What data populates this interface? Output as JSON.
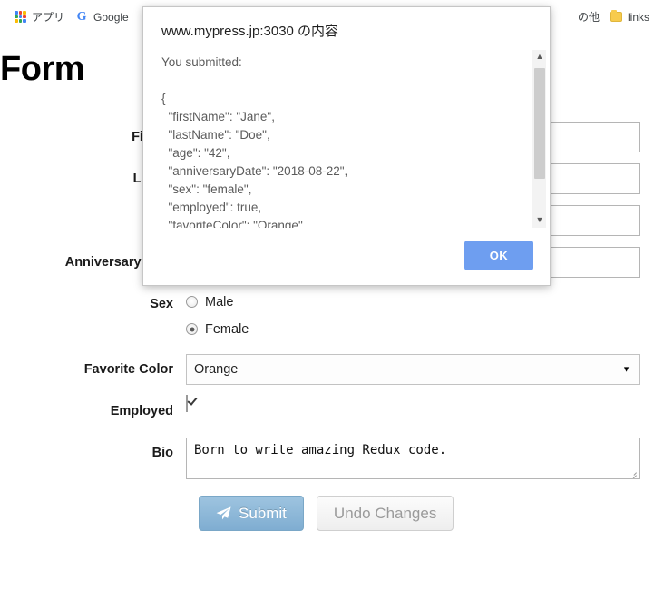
{
  "browser": {
    "bookmarks": [
      {
        "label": "アプリ",
        "icon": "apps-grid-icon"
      },
      {
        "label": "Google",
        "icon": "google-g-icon"
      }
    ],
    "right_bookmarks": [
      {
        "label": "の他",
        "icon": "none"
      },
      {
        "label": "links",
        "icon": "folder-icon"
      }
    ]
  },
  "page": {
    "title": "Form"
  },
  "form": {
    "fields": [
      {
        "label": "First N",
        "value": "",
        "type": "text"
      },
      {
        "label": "Last N",
        "value": "",
        "type": "text"
      },
      {
        "label": "",
        "value": "",
        "type": "text"
      }
    ],
    "anniversary": {
      "label": "Anniversary Date",
      "value": "2018/08/22"
    },
    "sex": {
      "label": "Sex",
      "options": [
        {
          "label": "Male",
          "checked": false
        },
        {
          "label": "Female",
          "checked": true
        }
      ]
    },
    "favorite_color": {
      "label": "Favorite Color",
      "value": "Orange"
    },
    "employed": {
      "label": "Employed",
      "checked": true
    },
    "bio": {
      "label": "Bio",
      "value": "Born to write amazing Redux code."
    },
    "buttons": {
      "submit": "Submit",
      "undo": "Undo Changes"
    }
  },
  "dialog": {
    "title": "www.mypress.jp:3030 の内容",
    "body": "You submitted:\n\n{\n  \"firstName\": \"Jane\",\n  \"lastName\": \"Doe\",\n  \"age\": \"42\",\n  \"anniversaryDate\": \"2018-08-22\",\n  \"sex\": \"female\",\n  \"employed\": true,\n  \"favoriteColor\": \"Orange\"",
    "ok_label": "OK"
  },
  "colors": {
    "ok_button": "#6e9ef0",
    "submit_button": "#7fadd1",
    "folder": "#f7cb4d"
  }
}
